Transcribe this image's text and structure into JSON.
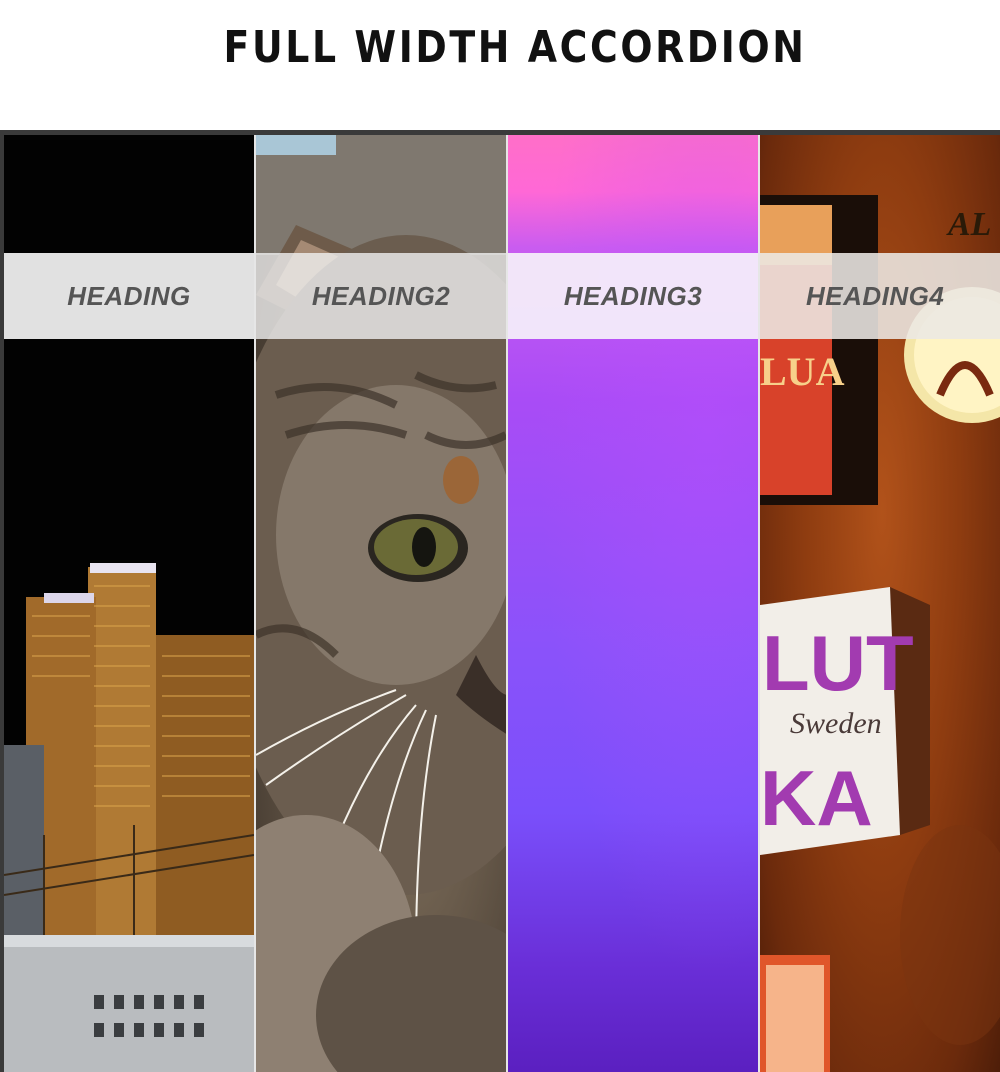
{
  "page": {
    "title": "FULL WIDTH ACCORDION"
  },
  "accordion": {
    "panels": [
      {
        "heading": "HEADING",
        "image": "city-night-photo"
      },
      {
        "heading": "HEADING2",
        "image": "cat-photo"
      },
      {
        "heading": "HEADING3",
        "image": "pink-purple-gradient"
      },
      {
        "heading": "HEADING4",
        "image": "bar-signs-photo"
      }
    ]
  },
  "signs": {
    "sign_top": "LUA",
    "sign_main_1": "LUT",
    "sign_main_2": "Sweden",
    "sign_main_3": "KA",
    "lamp_text": "AL"
  },
  "colors": {
    "frame": "#3a3a3a",
    "heading_text": "#555555",
    "gradient_top": "#ff6fc8",
    "gradient_bottom": "#5a1fbf"
  }
}
